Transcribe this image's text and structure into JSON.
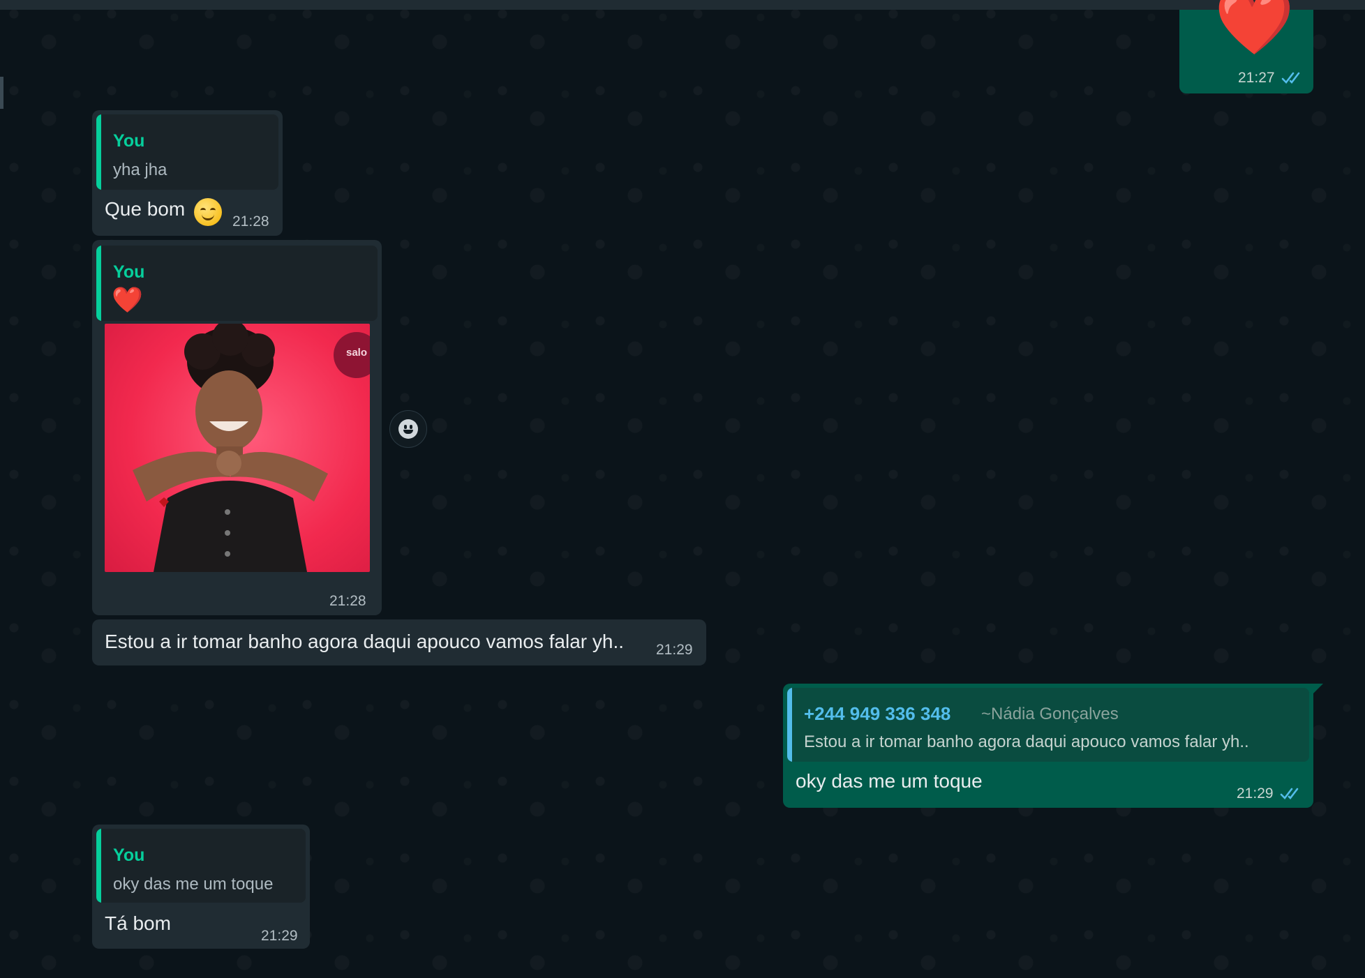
{
  "messages": [
    {
      "id": "m1",
      "direction": "outgoing",
      "content": "❤️",
      "time": "21:27",
      "status": "read"
    },
    {
      "id": "m2",
      "direction": "incoming",
      "reply": {
        "author": "You",
        "text": "yha jha"
      },
      "text": "Que bom",
      "emoji": "smiling-face-icon",
      "time": "21:28"
    },
    {
      "id": "m3",
      "direction": "incoming",
      "reply": {
        "author": "You",
        "text": "❤️"
      },
      "media": {
        "type": "image",
        "logo_text": "salo"
      },
      "time": "21:28"
    },
    {
      "id": "m4",
      "direction": "incoming",
      "text": "Estou a ir tomar banho agora daqui apouco vamos falar yh..",
      "time": "21:29"
    },
    {
      "id": "m5",
      "direction": "outgoing",
      "reply": {
        "author": "+244 949 336 348",
        "author_name": "~Nádia Gonçalves",
        "text": "Estou a ir tomar banho agora daqui apouco vamos falar yh.."
      },
      "text": "oky das me um toque",
      "time": "21:29",
      "status": "read"
    },
    {
      "id": "m6",
      "direction": "incoming",
      "reply": {
        "author": "You",
        "text": "oky das me um toque"
      },
      "text": "Tá bom",
      "time": "21:29"
    }
  ],
  "colors": {
    "background": "#0b141a",
    "incoming_bubble": "#202c33",
    "outgoing_bubble": "#005c4b",
    "accent_green": "#06cf9c",
    "read_tick_blue": "#53bdeb"
  },
  "icons": {
    "react": "emoji-react-icon",
    "read_status": "double-check-icon"
  }
}
